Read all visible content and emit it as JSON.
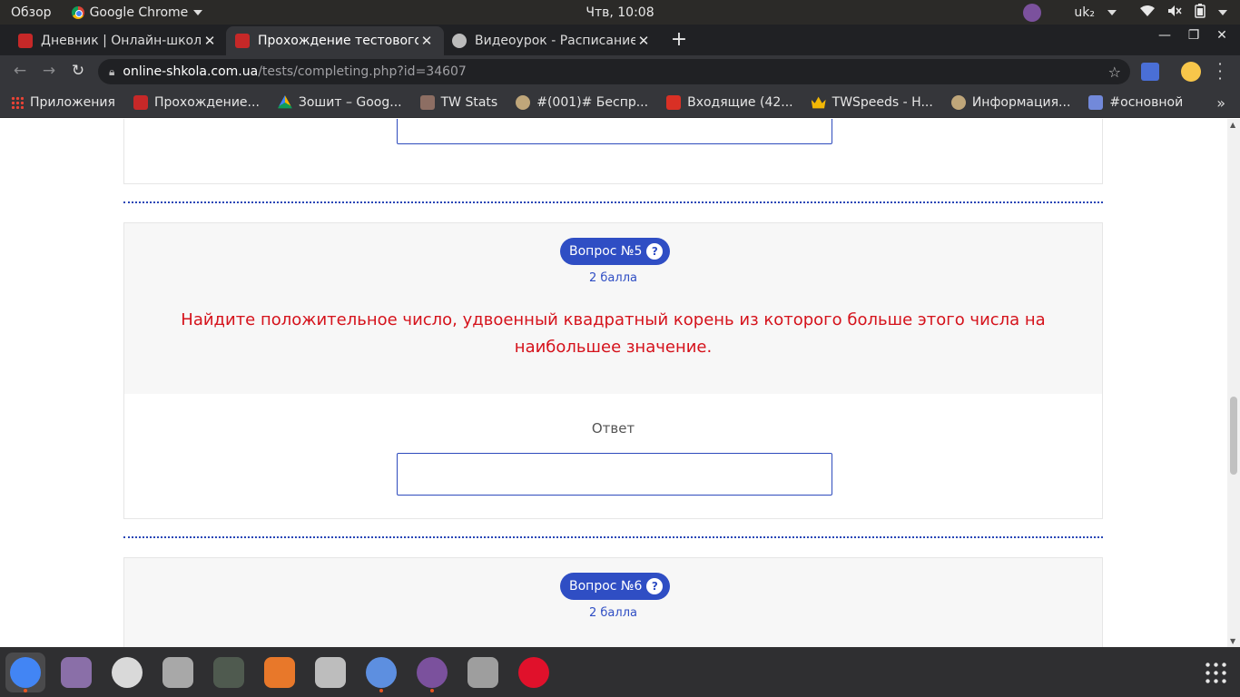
{
  "os_panel": {
    "overview": "Обзор",
    "app_name": "Google Chrome",
    "clock": "Чтв, 10:08",
    "keyboard_layout": "uk₂"
  },
  "tabs": [
    {
      "title": "Дневник | Онлайн-школа",
      "favicon_color": "#c62828"
    },
    {
      "title": "Прохождение тестового",
      "favicon_color": "#c62828"
    },
    {
      "title": "Видеоурок - Расписание",
      "favicon_color": "#bbbbbb"
    }
  ],
  "toolbar": {
    "url_host": "online-shkola.com.ua",
    "url_path": "/tests/completing.php?id=34607"
  },
  "bookmarks": [
    {
      "label": "Приложения",
      "icon": "apps-grid-icon",
      "color": "#ea4335"
    },
    {
      "label": "Прохождение...",
      "icon": "school-icon",
      "color": "#c62828"
    },
    {
      "label": "Зошит – Goog...",
      "icon": "google-drive-icon",
      "color": "#f4b400"
    },
    {
      "label": "TW Stats",
      "icon": "tw-stats-icon",
      "color": "#8d6e63"
    },
    {
      "label": "#(001)# Беспр...",
      "icon": "tw-icon",
      "color": "#bfa67a"
    },
    {
      "label": "Входящие (42...",
      "icon": "gmail-icon",
      "color": "#d93025"
    },
    {
      "label": "TWSpeeds - H...",
      "icon": "crown-icon",
      "color": "#f2b705"
    },
    {
      "label": "Информация...",
      "icon": "tw-icon",
      "color": "#bfa67a"
    },
    {
      "label": "#основной",
      "icon": "discord-icon",
      "color": "#7289da"
    }
  ],
  "page": {
    "question5": {
      "badge": "Вопрос №5",
      "help": "?",
      "points": "2 балла",
      "text": "Найдите положительное число, удвоенный квадратный корень из которого больше этого числа на наибольшее значение.",
      "answer_label": "Ответ",
      "answer_value": ""
    },
    "question6": {
      "badge": "Вопрос №6",
      "help": "?",
      "points": "2 балла"
    },
    "colors": {
      "accent": "#2f4ec4",
      "question_text": "#d5121b"
    }
  },
  "dock": [
    {
      "name": "chrome-icon",
      "color": "#4285f4",
      "running": true
    },
    {
      "name": "image-viewer-icon",
      "color": "#8a6fa8",
      "running": false
    },
    {
      "name": "webcam-icon",
      "color": "#d9d9d9",
      "running": false
    },
    {
      "name": "files-icon",
      "color": "#a8a8a8",
      "running": false
    },
    {
      "name": "calculator-icon",
      "color": "#4f5a4f",
      "running": false
    },
    {
      "name": "software-center-icon",
      "color": "#e8782a",
      "running": false
    },
    {
      "name": "camera-icon",
      "color": "#bdbdbd",
      "running": false
    },
    {
      "name": "chromium-icon",
      "color": "#5d8fe0",
      "running": true
    },
    {
      "name": "viber-icon",
      "color": "#7b519d",
      "running": true
    },
    {
      "name": "settings-icon",
      "color": "#9e9e9e",
      "running": false
    },
    {
      "name": "opera-icon",
      "color": "#e0112b",
      "running": false
    }
  ]
}
